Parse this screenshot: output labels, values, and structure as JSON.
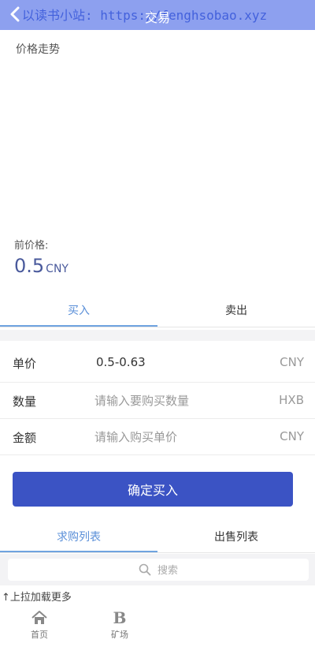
{
  "header": {
    "title": "交易",
    "watermark": "以读书小站: https://fenghsobao.xyz"
  },
  "trend": {
    "title": "价格走势"
  },
  "price": {
    "label": "前价格:",
    "value": "0.5",
    "unit": "CNY"
  },
  "tabs": {
    "buy": "买入",
    "sell": "卖出"
  },
  "form": {
    "unit_price": {
      "label": "单价",
      "value": "0.5-0.63",
      "unit": "CNY"
    },
    "quantity": {
      "label": "数量",
      "placeholder": "请输入要购买数量",
      "unit": "HXB"
    },
    "amount": {
      "label": "金额",
      "placeholder": "请输入购买单价",
      "unit": "CNY"
    },
    "confirm_label": "确定买入"
  },
  "list_tabs": {
    "buy_orders": "求购列表",
    "sell_orders": "出售列表"
  },
  "search": {
    "placeholder": "搜索"
  },
  "load_more": "↑上拉加载更多",
  "nav": {
    "home": "首页",
    "mine_label": "矿场",
    "mine_glyph": "B"
  },
  "colors": {
    "header_bg": "#8da0ef",
    "accent": "#3b53c4",
    "tab_active": "#5a8fd8"
  },
  "icons": {
    "back": "chevron-left-icon",
    "search": "search-icon",
    "home": "home-icon",
    "mine": "b-icon"
  }
}
